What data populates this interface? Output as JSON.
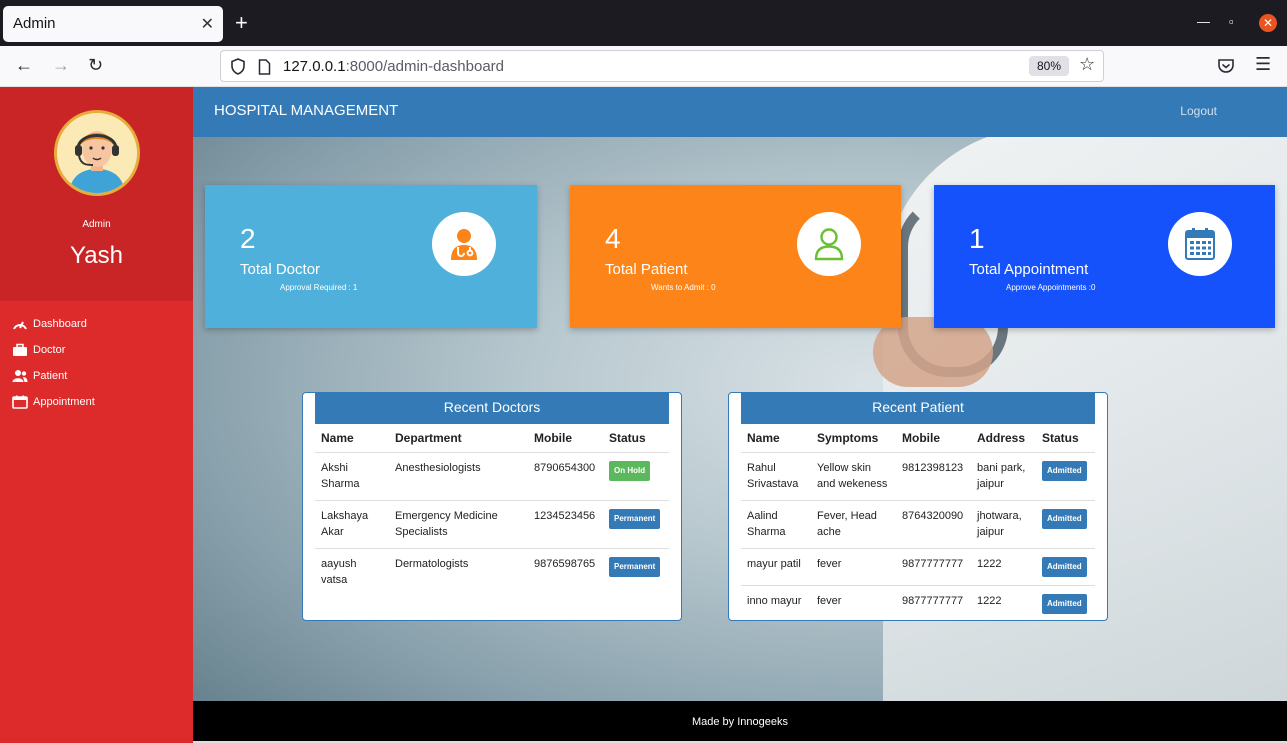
{
  "browser": {
    "tab_title": "Admin",
    "url_host": "127.0.0.1",
    "url_rest": ":8000/admin-dashboard",
    "zoom": "80%"
  },
  "sidebar": {
    "role": "Admin",
    "username": "Yash",
    "items": [
      {
        "label": "Dashboard",
        "icon": "dashboard-icon"
      },
      {
        "label": "Doctor",
        "icon": "briefcase-icon"
      },
      {
        "label": "Patient",
        "icon": "users-icon"
      },
      {
        "label": "Appointment",
        "icon": "calendar-icon"
      }
    ]
  },
  "header": {
    "brand": "HOSPITAL MANAGEMENT",
    "logout": "Logout"
  },
  "cards": [
    {
      "count": "2",
      "label": "Total Doctor",
      "sub": "Approval Required : 1",
      "color": "#4fb0dc",
      "icon": "doctor-icon"
    },
    {
      "count": "4",
      "label": "Total Patient",
      "sub": "Wants to Admit : 0",
      "color": "#fd8418",
      "icon": "user-icon"
    },
    {
      "count": "1",
      "label": "Total Appointment",
      "sub": "Approve Appointments :0",
      "color": "#1552fb",
      "icon": "calendar-icon"
    }
  ],
  "recent_doctors": {
    "title": "Recent Doctors",
    "columns": [
      "Name",
      "Department",
      "Mobile",
      "Status"
    ],
    "rows": [
      {
        "name": "Akshi Sharma",
        "department": "Anesthesiologists",
        "mobile": "8790654300",
        "status": "On Hold",
        "status_color": "#5cb85c"
      },
      {
        "name": "Lakshaya Akar",
        "department": "Emergency Medicine Specialists",
        "mobile": "1234523456",
        "status": "Permanent",
        "status_color": "#337ab7"
      },
      {
        "name": "aayush vatsa",
        "department": "Dermatologists",
        "mobile": "9876598765",
        "status": "Permanent",
        "status_color": "#337ab7"
      }
    ]
  },
  "recent_patients": {
    "title": "Recent Patient",
    "columns": [
      "Name",
      "Symptoms",
      "Mobile",
      "Address",
      "Status"
    ],
    "rows": [
      {
        "name": "Rahul Srivastava",
        "symptoms": "Yellow skin and wekeness",
        "mobile": "9812398123",
        "address": "bani park, jaipur",
        "status": "Admitted"
      },
      {
        "name": "Aalind Sharma",
        "symptoms": "Fever, Head ache",
        "mobile": "8764320090",
        "address": "jhotwara, jaipur",
        "status": "Admitted"
      },
      {
        "name": "mayur patil",
        "symptoms": "fever",
        "mobile": "9877777777",
        "address": "1222",
        "status": "Admitted"
      },
      {
        "name": "inno mayur",
        "symptoms": "fever",
        "mobile": "9877777777",
        "address": "1222",
        "status": "Admitted"
      }
    ]
  },
  "footer": {
    "text": "Made by Innogeeks"
  }
}
